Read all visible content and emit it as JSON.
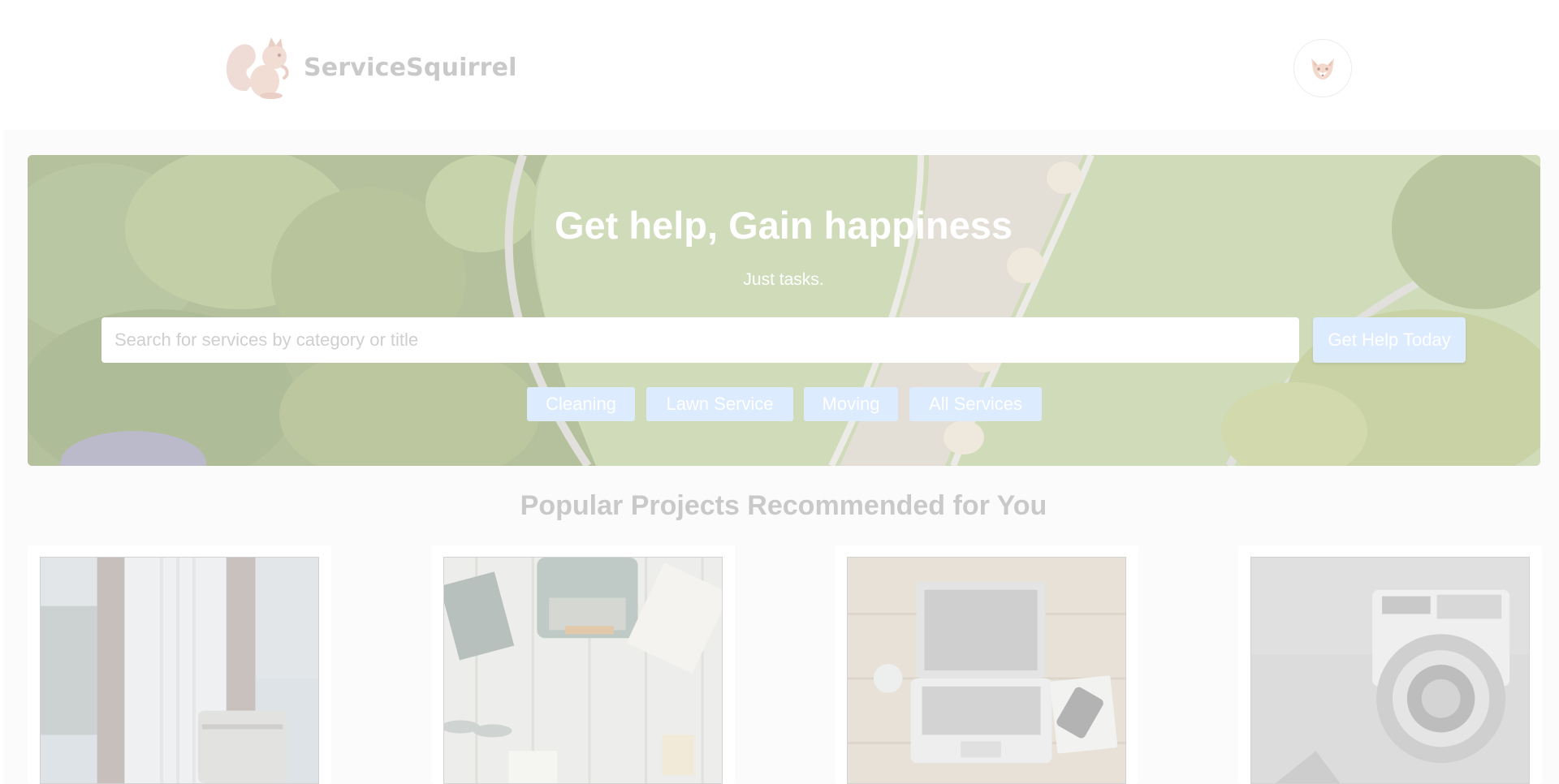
{
  "header": {
    "brand_name": "ServiceSquirrel",
    "logo_icon": "squirrel-logo-icon",
    "avatar_icon": "fox-avatar-icon"
  },
  "hero": {
    "title": "Get help, Gain happiness",
    "subtitle": "Just tasks.",
    "search_placeholder": "Search for services by category or title",
    "search_value": "",
    "search_button_label": "Get Help Today",
    "categories": [
      {
        "label": "Cleaning"
      },
      {
        "label": "Lawn Service"
      },
      {
        "label": "Moving"
      },
      {
        "label": "All Services"
      }
    ]
  },
  "recommended": {
    "title": "Popular Projects Recommended for You",
    "cards": [
      {
        "image": "window-curtains-photo"
      },
      {
        "image": "typewriter-desk-photo"
      },
      {
        "image": "laptop-desk-photo"
      },
      {
        "image": "vintage-camera-photo"
      }
    ]
  },
  "colors": {
    "accent_button": "#dcebfd",
    "brand_text": "#c9c9c9",
    "page_background": "#fbfbfc"
  }
}
